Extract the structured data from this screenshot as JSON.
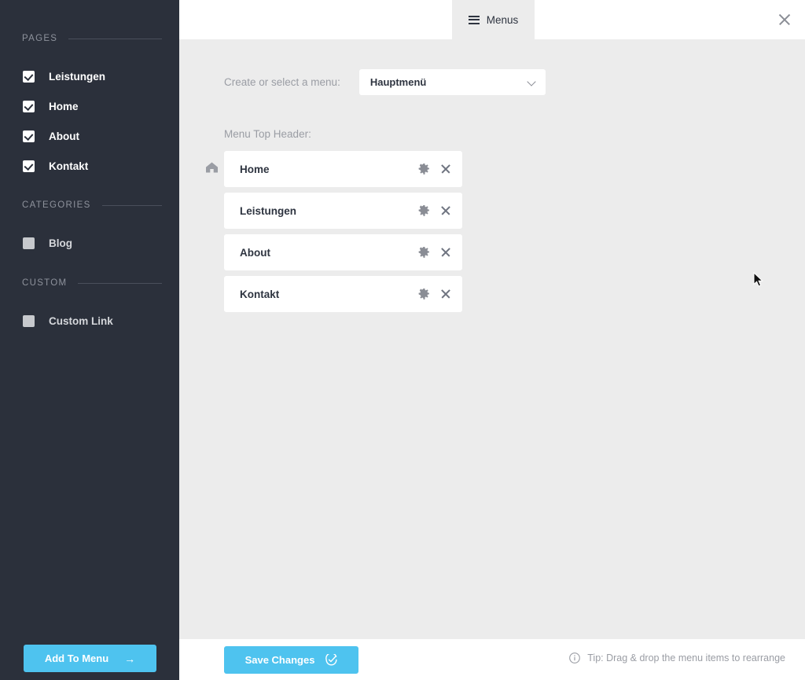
{
  "sidebar": {
    "sections": [
      {
        "title": "PAGES",
        "items": [
          {
            "label": "Leistungen",
            "checked": true
          },
          {
            "label": "Home",
            "checked": true
          },
          {
            "label": "About",
            "checked": true
          },
          {
            "label": "Kontakt",
            "checked": true
          }
        ]
      },
      {
        "title": "CATEGORIES",
        "items": [
          {
            "label": "Blog",
            "checked": false
          }
        ]
      },
      {
        "title": "CUSTOM",
        "items": [
          {
            "label": "Custom Link",
            "checked": false
          }
        ]
      }
    ],
    "add_button": {
      "label": "Add To Menu",
      "icon": "arrow-right-icon"
    }
  },
  "topbar": {
    "tab": {
      "label": "Menus",
      "icon": "hamburger-icon"
    },
    "close_icon": "close-icon"
  },
  "main": {
    "select_row": {
      "label": "Create or select a menu:",
      "selected": "Hauptmenü",
      "chevron_icon": "chevron-down-icon"
    },
    "menu_header_label": "Menu Top Header:",
    "items": [
      {
        "label": "Home",
        "home_icon": true
      },
      {
        "label": "Leistungen",
        "home_icon": false
      },
      {
        "label": "About",
        "home_icon": false
      },
      {
        "label": "Kontakt",
        "home_icon": false
      }
    ],
    "row_icons": {
      "settings": "gear-icon",
      "remove": "close-icon"
    }
  },
  "footer": {
    "save_label": "Save Changes",
    "save_icon": "check-circle-icon",
    "tip_icon": "info-icon",
    "tip_text": "Tip: Drag & drop the menu items to rearrange"
  },
  "colors": {
    "sidebar_bg": "#2b303b",
    "accent": "#4ec3ef",
    "content_bg": "#ececec",
    "card_bg": "#ffffff",
    "muted_text": "#9a9da4"
  }
}
